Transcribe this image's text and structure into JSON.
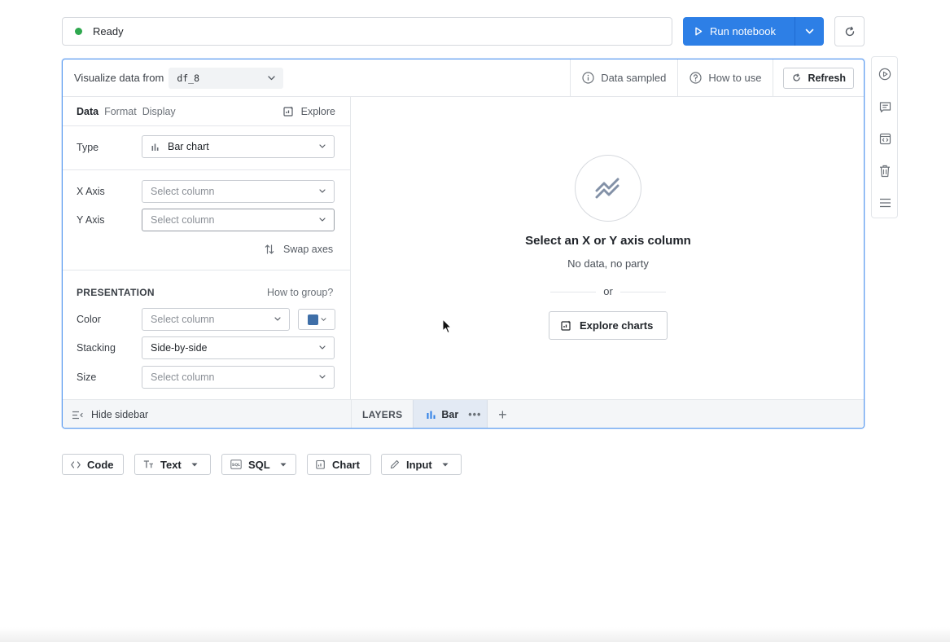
{
  "colors": {
    "accent": "#2d7fe6",
    "status_ok": "#2fa84f",
    "color_swatch": "#3f6fa8"
  },
  "status": {
    "text": "Ready"
  },
  "toolbar": {
    "run_label": "Run notebook"
  },
  "header": {
    "visualize_label": "Visualize data from",
    "dataframe": "df_8",
    "data_sampled": "Data sampled",
    "how_to_use": "How to use",
    "refresh": "Refresh"
  },
  "sidebar": {
    "tabs": [
      "Data",
      "Format",
      "Display"
    ],
    "explore": "Explore",
    "type_label": "Type",
    "type_value": "Bar chart",
    "x_axis_label": "X Axis",
    "x_axis_placeholder": "Select column",
    "y_axis_label": "Y Axis",
    "y_axis_placeholder": "Select column",
    "swap_axes": "Swap axes",
    "presentation_title": "PRESENTATION",
    "how_to_group": "How to group?",
    "color_label": "Color",
    "color_placeholder": "Select column",
    "stacking_label": "Stacking",
    "stacking_value": "Side-by-side",
    "size_label": "Size",
    "size_placeholder": "Select column",
    "hide_sidebar": "Hide sidebar"
  },
  "layers": {
    "label": "LAYERS",
    "tab": "Bar",
    "more": "•••",
    "add": "+"
  },
  "empty_state": {
    "title": "Select an X or Y axis column",
    "subtitle": "No data, no party",
    "or": "or",
    "explore_charts": "Explore charts"
  },
  "rail": {
    "icons": [
      "play-circle-icon",
      "comment-icon",
      "code-block-icon",
      "trash-icon",
      "menu-icon"
    ]
  },
  "add_cells": {
    "code": "Code",
    "text": "Text",
    "sql": "SQL",
    "chart": "Chart",
    "input": "Input"
  }
}
